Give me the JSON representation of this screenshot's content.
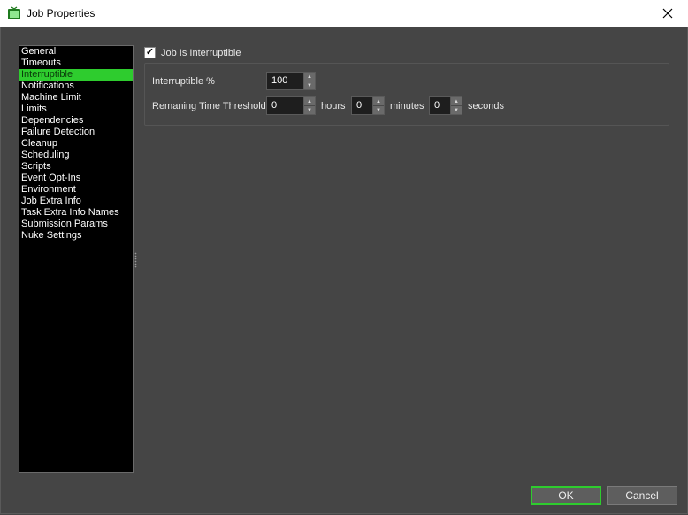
{
  "window": {
    "title": "Job Properties",
    "icon": "tv-icon",
    "close_icon": "close-icon"
  },
  "sidebar": {
    "items": [
      {
        "label": "General"
      },
      {
        "label": "Timeouts"
      },
      {
        "label": "Interruptible",
        "selected": true
      },
      {
        "label": "Notifications"
      },
      {
        "label": "Machine Limit"
      },
      {
        "label": "Limits"
      },
      {
        "label": "Dependencies"
      },
      {
        "label": "Failure Detection"
      },
      {
        "label": "Cleanup"
      },
      {
        "label": "Scheduling"
      },
      {
        "label": "Scripts"
      },
      {
        "label": "Event Opt-Ins"
      },
      {
        "label": "Environment"
      },
      {
        "label": "Job Extra Info"
      },
      {
        "label": "Task Extra Info Names"
      },
      {
        "label": "Submission Params"
      },
      {
        "label": "Nuke Settings"
      }
    ]
  },
  "interruptible": {
    "checkbox_label": "Job Is Interruptible",
    "checked": true,
    "check_mark": "✓",
    "percent_label": "Interruptible %",
    "percent_value": "100",
    "threshold_label": "Remaning Time Threshold",
    "hours_value": "0",
    "hours_label": "hours",
    "minutes_value": "0",
    "minutes_label": "minutes",
    "seconds_value": "0",
    "seconds_label": "seconds"
  },
  "footer": {
    "ok_label": "OK",
    "cancel_label": "Cancel"
  },
  "colors": {
    "accent": "#2ecc2e",
    "background": "#454545",
    "list_background": "#000000"
  }
}
